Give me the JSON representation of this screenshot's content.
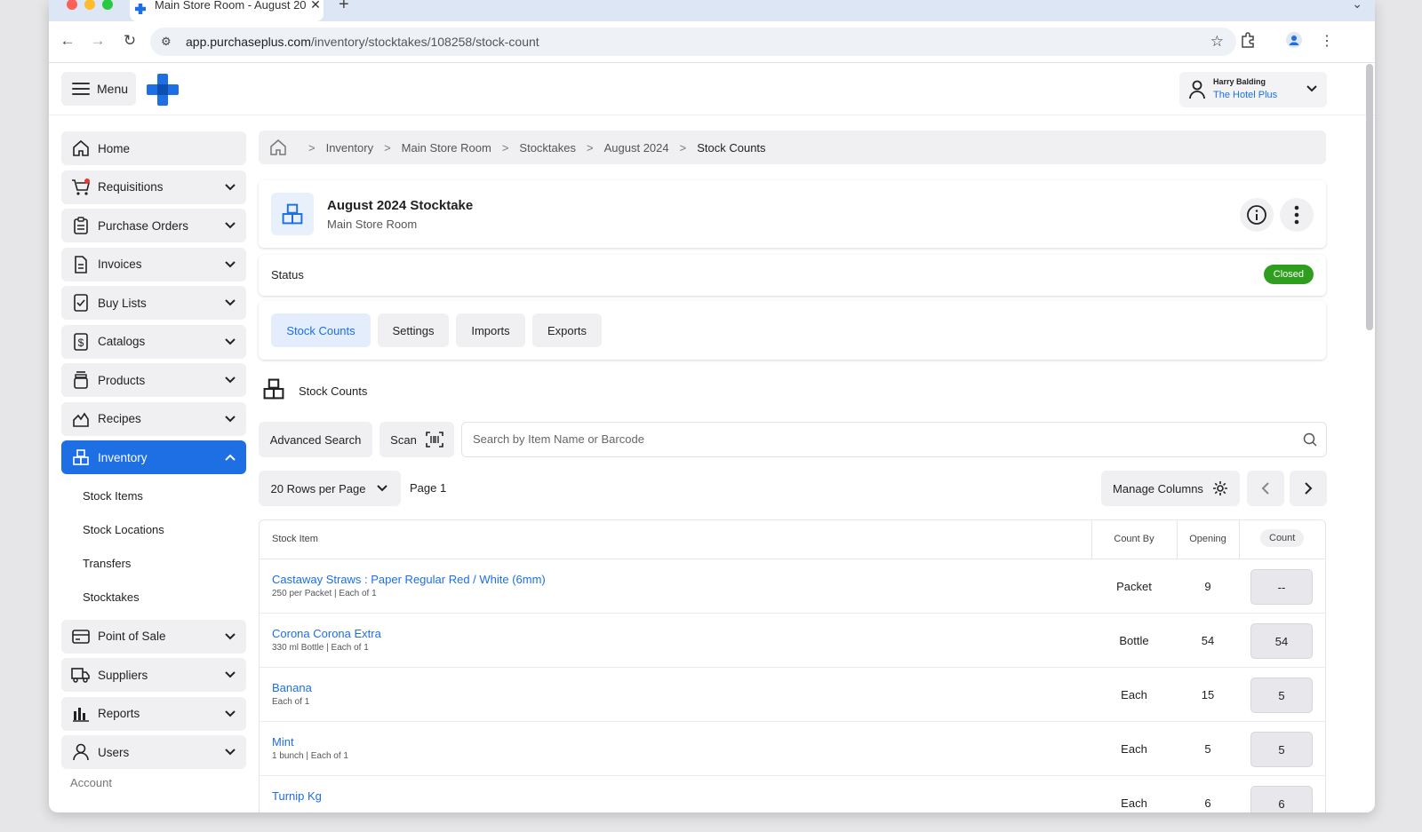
{
  "browser": {
    "tab_title": "Main Store Room - August 20",
    "url_host": "app.purchaseplus.com",
    "url_path": "/inventory/stocktakes/108258/stock-count"
  },
  "header": {
    "menu_label": "Menu",
    "user_name": "Harry Balding",
    "user_org": "The Hotel Plus"
  },
  "sidebar": {
    "items": [
      {
        "label": "Home",
        "icon": "home-icon"
      },
      {
        "label": "Requisitions",
        "icon": "cart-icon"
      },
      {
        "label": "Purchase Orders",
        "icon": "clipboard-icon"
      },
      {
        "label": "Invoices",
        "icon": "document-icon"
      },
      {
        "label": "Buy Lists",
        "icon": "checklist-icon"
      },
      {
        "label": "Catalogs",
        "icon": "dollar-doc-icon"
      },
      {
        "label": "Products",
        "icon": "jar-icon"
      },
      {
        "label": "Recipes",
        "icon": "chef-hat-icon"
      },
      {
        "label": "Inventory",
        "icon": "boxes-icon"
      }
    ],
    "inventory_sub": [
      "Stock Items",
      "Stock Locations",
      "Transfers",
      "Stocktakes"
    ],
    "items_after": [
      {
        "label": "Point of Sale",
        "icon": "card-icon"
      },
      {
        "label": "Suppliers",
        "icon": "truck-icon"
      },
      {
        "label": "Reports",
        "icon": "bar-chart-icon"
      },
      {
        "label": "Users",
        "icon": "user-icon"
      }
    ],
    "account_label": "Account"
  },
  "breadcrumb": [
    "Inventory",
    "Main Store Room",
    "Stocktakes",
    "August 2024",
    "Stock Counts"
  ],
  "page": {
    "title": "August 2024 Stocktake",
    "subtitle": "Main Store Room",
    "status_label": "Status",
    "status_value": "Closed",
    "status_color": "#2f9e1f",
    "tabs": [
      "Stock Counts",
      "Settings",
      "Imports",
      "Exports"
    ],
    "section_title": "Stock Counts"
  },
  "search": {
    "advanced_label": "Advanced Search",
    "scan_label": "Scan",
    "placeholder": "Search by Item Name or Barcode"
  },
  "paging": {
    "rows_per_page": "20 Rows per Page",
    "page_label": "Page 1",
    "manage_columns": "Manage Columns"
  },
  "table": {
    "headers": {
      "item": "Stock Item",
      "count_by": "Count By",
      "opening": "Opening",
      "count": "Count"
    },
    "rows": [
      {
        "name": "Castaway Straws : Paper Regular Red / White (6mm)",
        "desc": "250 per Packet | Each of 1",
        "count_by": "Packet",
        "opening": "9",
        "count": "--"
      },
      {
        "name": "Corona Corona Extra",
        "desc": "330 ml Bottle | Each of 1",
        "count_by": "Bottle",
        "opening": "54",
        "count": "54"
      },
      {
        "name": "Banana",
        "desc": "Each of 1",
        "count_by": "Each",
        "opening": "15",
        "count": "5"
      },
      {
        "name": "Mint",
        "desc": "1 bunch | Each of 1",
        "count_by": "Each",
        "opening": "5",
        "count": "5"
      },
      {
        "name": "Turnip Kg",
        "desc": "",
        "count_by": "Each",
        "opening": "6",
        "count": "6"
      }
    ]
  },
  "colors": {
    "accent": "#1d6fe3",
    "sidebar_bg": "#f0f0f2"
  }
}
